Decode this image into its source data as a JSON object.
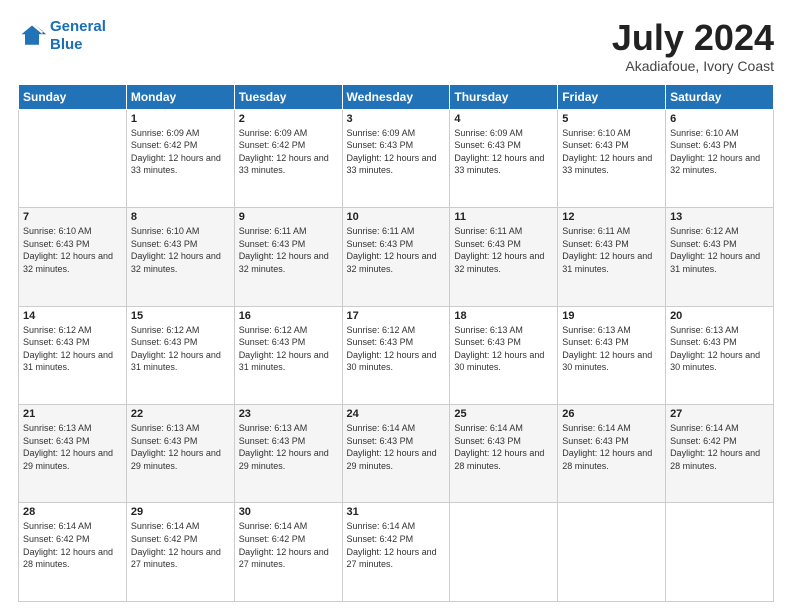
{
  "header": {
    "logo_line1": "General",
    "logo_line2": "Blue",
    "month": "July 2024",
    "location": "Akadiafoue, Ivory Coast"
  },
  "days_of_week": [
    "Sunday",
    "Monday",
    "Tuesday",
    "Wednesday",
    "Thursday",
    "Friday",
    "Saturday"
  ],
  "weeks": [
    [
      {
        "day": "",
        "sunrise": "",
        "sunset": "",
        "daylight": ""
      },
      {
        "day": "1",
        "sunrise": "Sunrise: 6:09 AM",
        "sunset": "Sunset: 6:42 PM",
        "daylight": "Daylight: 12 hours and 33 minutes."
      },
      {
        "day": "2",
        "sunrise": "Sunrise: 6:09 AM",
        "sunset": "Sunset: 6:42 PM",
        "daylight": "Daylight: 12 hours and 33 minutes."
      },
      {
        "day": "3",
        "sunrise": "Sunrise: 6:09 AM",
        "sunset": "Sunset: 6:43 PM",
        "daylight": "Daylight: 12 hours and 33 minutes."
      },
      {
        "day": "4",
        "sunrise": "Sunrise: 6:09 AM",
        "sunset": "Sunset: 6:43 PM",
        "daylight": "Daylight: 12 hours and 33 minutes."
      },
      {
        "day": "5",
        "sunrise": "Sunrise: 6:10 AM",
        "sunset": "Sunset: 6:43 PM",
        "daylight": "Daylight: 12 hours and 33 minutes."
      },
      {
        "day": "6",
        "sunrise": "Sunrise: 6:10 AM",
        "sunset": "Sunset: 6:43 PM",
        "daylight": "Daylight: 12 hours and 32 minutes."
      }
    ],
    [
      {
        "day": "7",
        "sunrise": "Sunrise: 6:10 AM",
        "sunset": "Sunset: 6:43 PM",
        "daylight": "Daylight: 12 hours and 32 minutes."
      },
      {
        "day": "8",
        "sunrise": "Sunrise: 6:10 AM",
        "sunset": "Sunset: 6:43 PM",
        "daylight": "Daylight: 12 hours and 32 minutes."
      },
      {
        "day": "9",
        "sunrise": "Sunrise: 6:11 AM",
        "sunset": "Sunset: 6:43 PM",
        "daylight": "Daylight: 12 hours and 32 minutes."
      },
      {
        "day": "10",
        "sunrise": "Sunrise: 6:11 AM",
        "sunset": "Sunset: 6:43 PM",
        "daylight": "Daylight: 12 hours and 32 minutes."
      },
      {
        "day": "11",
        "sunrise": "Sunrise: 6:11 AM",
        "sunset": "Sunset: 6:43 PM",
        "daylight": "Daylight: 12 hours and 32 minutes."
      },
      {
        "day": "12",
        "sunrise": "Sunrise: 6:11 AM",
        "sunset": "Sunset: 6:43 PM",
        "daylight": "Daylight: 12 hours and 31 minutes."
      },
      {
        "day": "13",
        "sunrise": "Sunrise: 6:12 AM",
        "sunset": "Sunset: 6:43 PM",
        "daylight": "Daylight: 12 hours and 31 minutes."
      }
    ],
    [
      {
        "day": "14",
        "sunrise": "Sunrise: 6:12 AM",
        "sunset": "Sunset: 6:43 PM",
        "daylight": "Daylight: 12 hours and 31 minutes."
      },
      {
        "day": "15",
        "sunrise": "Sunrise: 6:12 AM",
        "sunset": "Sunset: 6:43 PM",
        "daylight": "Daylight: 12 hours and 31 minutes."
      },
      {
        "day": "16",
        "sunrise": "Sunrise: 6:12 AM",
        "sunset": "Sunset: 6:43 PM",
        "daylight": "Daylight: 12 hours and 31 minutes."
      },
      {
        "day": "17",
        "sunrise": "Sunrise: 6:12 AM",
        "sunset": "Sunset: 6:43 PM",
        "daylight": "Daylight: 12 hours and 30 minutes."
      },
      {
        "day": "18",
        "sunrise": "Sunrise: 6:13 AM",
        "sunset": "Sunset: 6:43 PM",
        "daylight": "Daylight: 12 hours and 30 minutes."
      },
      {
        "day": "19",
        "sunrise": "Sunrise: 6:13 AM",
        "sunset": "Sunset: 6:43 PM",
        "daylight": "Daylight: 12 hours and 30 minutes."
      },
      {
        "day": "20",
        "sunrise": "Sunrise: 6:13 AM",
        "sunset": "Sunset: 6:43 PM",
        "daylight": "Daylight: 12 hours and 30 minutes."
      }
    ],
    [
      {
        "day": "21",
        "sunrise": "Sunrise: 6:13 AM",
        "sunset": "Sunset: 6:43 PM",
        "daylight": "Daylight: 12 hours and 29 minutes."
      },
      {
        "day": "22",
        "sunrise": "Sunrise: 6:13 AM",
        "sunset": "Sunset: 6:43 PM",
        "daylight": "Daylight: 12 hours and 29 minutes."
      },
      {
        "day": "23",
        "sunrise": "Sunrise: 6:13 AM",
        "sunset": "Sunset: 6:43 PM",
        "daylight": "Daylight: 12 hours and 29 minutes."
      },
      {
        "day": "24",
        "sunrise": "Sunrise: 6:14 AM",
        "sunset": "Sunset: 6:43 PM",
        "daylight": "Daylight: 12 hours and 29 minutes."
      },
      {
        "day": "25",
        "sunrise": "Sunrise: 6:14 AM",
        "sunset": "Sunset: 6:43 PM",
        "daylight": "Daylight: 12 hours and 28 minutes."
      },
      {
        "day": "26",
        "sunrise": "Sunrise: 6:14 AM",
        "sunset": "Sunset: 6:43 PM",
        "daylight": "Daylight: 12 hours and 28 minutes."
      },
      {
        "day": "27",
        "sunrise": "Sunrise: 6:14 AM",
        "sunset": "Sunset: 6:42 PM",
        "daylight": "Daylight: 12 hours and 28 minutes."
      }
    ],
    [
      {
        "day": "28",
        "sunrise": "Sunrise: 6:14 AM",
        "sunset": "Sunset: 6:42 PM",
        "daylight": "Daylight: 12 hours and 28 minutes."
      },
      {
        "day": "29",
        "sunrise": "Sunrise: 6:14 AM",
        "sunset": "Sunset: 6:42 PM",
        "daylight": "Daylight: 12 hours and 27 minutes."
      },
      {
        "day": "30",
        "sunrise": "Sunrise: 6:14 AM",
        "sunset": "Sunset: 6:42 PM",
        "daylight": "Daylight: 12 hours and 27 minutes."
      },
      {
        "day": "31",
        "sunrise": "Sunrise: 6:14 AM",
        "sunset": "Sunset: 6:42 PM",
        "daylight": "Daylight: 12 hours and 27 minutes."
      },
      {
        "day": "",
        "sunrise": "",
        "sunset": "",
        "daylight": ""
      },
      {
        "day": "",
        "sunrise": "",
        "sunset": "",
        "daylight": ""
      },
      {
        "day": "",
        "sunrise": "",
        "sunset": "",
        "daylight": ""
      }
    ]
  ]
}
